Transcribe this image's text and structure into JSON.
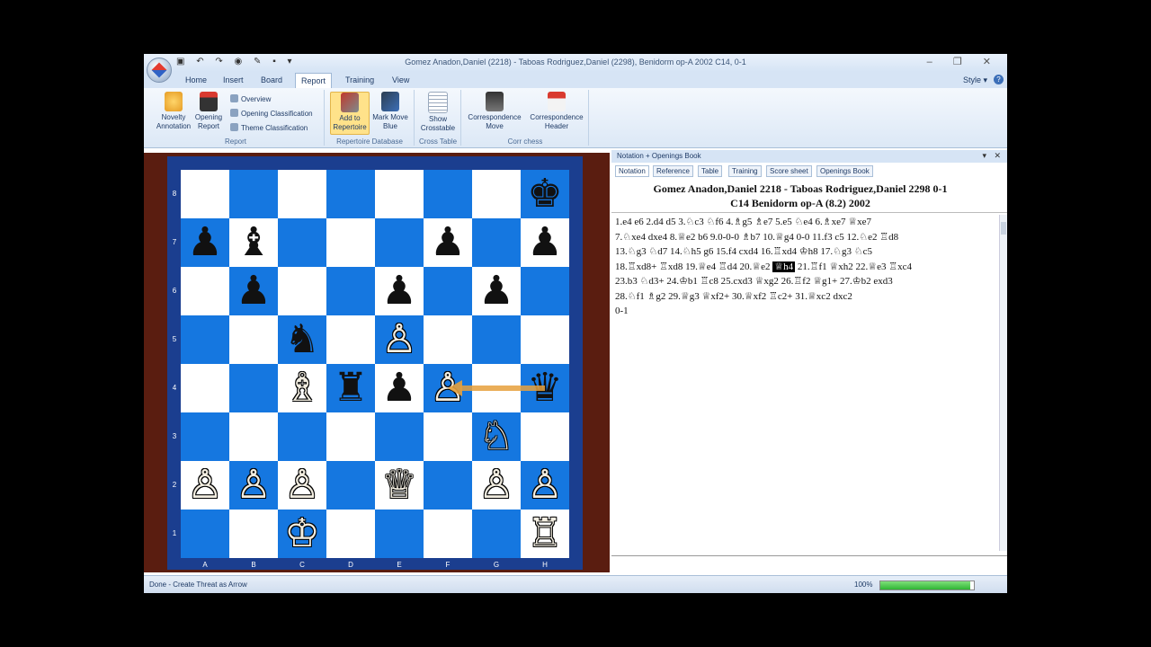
{
  "window": {
    "title": "Gomez Anadon,Daniel (2218) - Taboas Rodriguez,Daniel (2298), Benidorm op-A 2002  C14, 0-1",
    "qat_icons": [
      "save-icon",
      "undo-icon",
      "redo-icon",
      "engine-icon",
      "flag-icon",
      "folder-icon",
      "dropdown-icon"
    ],
    "controls": [
      "–",
      "❐",
      "✕"
    ]
  },
  "ribbon_tabs": [
    {
      "label": "Home"
    },
    {
      "label": "Insert"
    },
    {
      "label": "Board"
    },
    {
      "label": "Report",
      "active": true
    },
    {
      "label": "Training"
    },
    {
      "label": "View"
    }
  ],
  "style_menu": "Style",
  "help": "?",
  "ribbon": {
    "report_group": {
      "label": "Report",
      "novelty": "Novelty Annotation",
      "opening_report": "Opening Report",
      "overview": "Overview",
      "opening_classification": "Opening Classification",
      "theme_classification": "Theme Classification"
    },
    "repertoire_group": {
      "label": "Repertoire Database",
      "add": "Add to Repertoire",
      "mark": "Mark Move Blue"
    },
    "cross_group": {
      "label": "Cross Table",
      "show": "Show Crosstable"
    },
    "corr_group": {
      "label": "Corr chess",
      "move": "Correspondence Move",
      "header": "Correspondence Header"
    }
  },
  "board": {
    "files": [
      "A",
      "B",
      "C",
      "D",
      "E",
      "F",
      "G",
      "H"
    ],
    "ranks": [
      "8",
      "7",
      "6",
      "5",
      "4",
      "3",
      "2",
      "1"
    ],
    "pieces": [
      {
        "sq": "h8",
        "glyph": "♚",
        "color": "b"
      },
      {
        "sq": "a7",
        "glyph": "♟",
        "color": "b"
      },
      {
        "sq": "b7",
        "glyph": "♝",
        "color": "b"
      },
      {
        "sq": "f7",
        "glyph": "♟",
        "color": "b"
      },
      {
        "sq": "h7",
        "glyph": "♟",
        "color": "b"
      },
      {
        "sq": "b6",
        "glyph": "♟",
        "color": "b"
      },
      {
        "sq": "e6",
        "glyph": "♟",
        "color": "b"
      },
      {
        "sq": "g6",
        "glyph": "♟",
        "color": "b"
      },
      {
        "sq": "c5",
        "glyph": "♞",
        "color": "b"
      },
      {
        "sq": "e5",
        "glyph": "♙",
        "color": "w"
      },
      {
        "sq": "c4",
        "glyph": "♗",
        "color": "w"
      },
      {
        "sq": "d4",
        "glyph": "♜",
        "color": "b"
      },
      {
        "sq": "e4",
        "glyph": "♟",
        "color": "b"
      },
      {
        "sq": "f4",
        "glyph": "♙",
        "color": "w"
      },
      {
        "sq": "h4",
        "glyph": "♛",
        "color": "b"
      },
      {
        "sq": "g3",
        "glyph": "♘",
        "color": "w"
      },
      {
        "sq": "a2",
        "glyph": "♙",
        "color": "w"
      },
      {
        "sq": "b2",
        "glyph": "♙",
        "color": "w"
      },
      {
        "sq": "c2",
        "glyph": "♙",
        "color": "w"
      },
      {
        "sq": "e2",
        "glyph": "♕",
        "color": "w"
      },
      {
        "sq": "g2",
        "glyph": "♙",
        "color": "w"
      },
      {
        "sq": "h2",
        "glyph": "♙",
        "color": "w"
      },
      {
        "sq": "c1",
        "glyph": "♔",
        "color": "w"
      },
      {
        "sq": "h1",
        "glyph": "♖",
        "color": "w"
      }
    ],
    "arrow": {
      "from": "h4",
      "to": "f4"
    },
    "colors": {
      "light": "#ffffff",
      "dark": "#1577e0",
      "frame": "#1b3e8f",
      "wood": "#5a1d10",
      "arrow": "#e6a03c"
    }
  },
  "notation_panel": {
    "title": "Notation + Openings Book",
    "controls": "▾ ✕",
    "tabs": [
      "Notation",
      "Reference",
      "Table",
      "Training",
      "Score sheet",
      "Openings Book"
    ],
    "header1": "Gomez Anadon,Daniel 2218 - Taboas Rodriguez,Daniel 2298  0-1",
    "header2": "C14 Benidorm op-A (8.2) 2002",
    "moves": [
      {
        "pre": "1.e4  e6  2.d4  d5  3.♘c3  ♘f6  4.♗g5  ♗e7  5.e5  ♘e4  6.♗xe7  ♕xe7"
      },
      {
        "pre": "7.♘xe4  dxe4  8.♕e2  b6  9.0-0-0  ♗b7  10.♕g4  0-0  11.f3  c5  12.♘e2  ♖d8"
      },
      {
        "pre": "13.♘g3  ♘d7  14.♘h5  g6  15.f4  cxd4  16.♖xd4  ♔h8  17.♘g3  ♘c5"
      },
      {
        "pre": "18.♖xd8+  ♖xd8  19.♕e4  ♖d4  20.♕e2 ",
        "hl": "♕h4",
        "post": " 21.♖f1  ♕xh2  22.♕e3  ♖xc4"
      },
      {
        "pre": "23.b3  ♘d3+  24.♔b1  ♖c8  25.cxd3  ♕xg2  26.♖f2  ♕g1+  27.♔b2  exd3"
      },
      {
        "pre": "28.♘f1  ♗g2  29.♕g3  ♕xf2+  30.♕xf2  ♖c2+  31.♕xc2  dxc2"
      },
      {
        "pre": "0-1"
      }
    ]
  },
  "statusbar": {
    "status": "Done - Create Threat as Arrow",
    "zoom": "100%",
    "progress": 0.96
  }
}
